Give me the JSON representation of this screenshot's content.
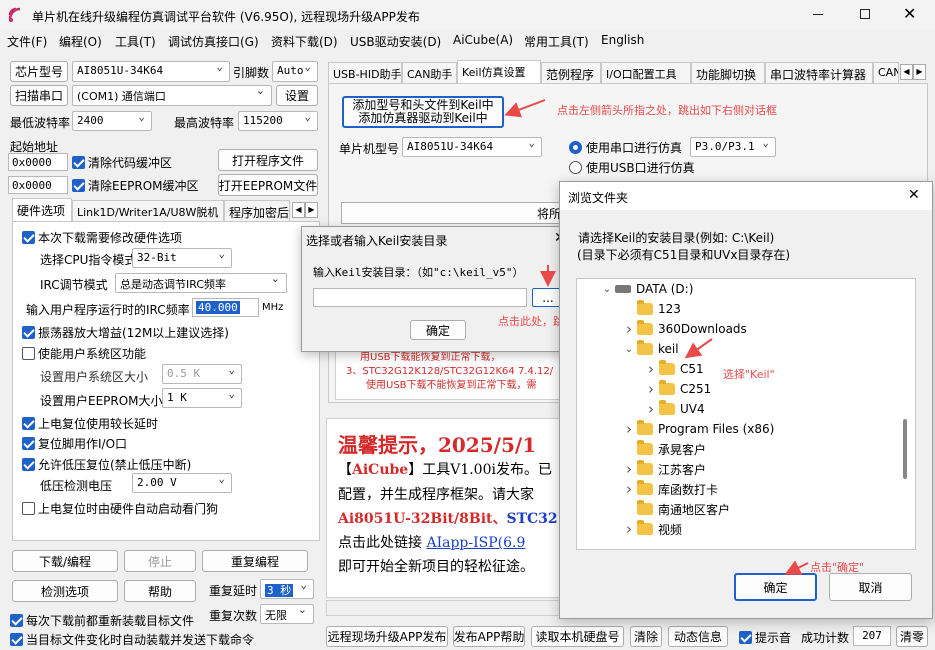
{
  "window": {
    "title": "单片机在线升级编程仿真调试平台软件 (V6.95O), 远程现场升级APP发布"
  },
  "menu": [
    "文件(F)",
    "编程(O)",
    "工具(T)",
    "调试仿真接口(G)",
    "资料下载(D)",
    "USB驱动安装(D)",
    "AiCube(A)",
    "常用工具(T)",
    "English"
  ],
  "left": {
    "chip_label": "芯片型号",
    "chip_value": "AI8051U-34K64",
    "pins_label": "引脚数",
    "pins_value": "Auto",
    "scan_button": "扫描串口",
    "port_value": "(COM1) 通信端口",
    "settings_button": "设置",
    "min_baud_label": "最低波特率",
    "min_baud_value": "2400",
    "max_baud_label": "最高波特率",
    "max_baud_value": "115200",
    "start_addr_label": "起始地址",
    "addr1": "0x0000",
    "clear_code": "清除代码缓冲区",
    "open_prog": "打开程序文件",
    "addr2": "0x0000",
    "clear_eeprom": "清除EEPROM缓冲区",
    "open_eeprom": "打开EEPROM文件",
    "tabs": [
      "硬件选项",
      "Link1D/Writer1A/U8W脱机",
      "程序加密后"
    ],
    "options": {
      "modify_hw": "本次下载需要修改硬件选项",
      "cpu_mode_label": "选择CPU指令模式",
      "cpu_mode_value": "32-Bit",
      "irc_label": "IRC调节模式",
      "irc_value": "总是动态调节IRC频率",
      "freq_label": "输入用户程序运行时的IRC频率",
      "freq_value": "40.000",
      "freq_unit": "MHz",
      "osc_gain": "振荡器放大增益(12M以上建议选择)",
      "user_sys": "使能用户系统区功能",
      "sys_size_label": "设置用户系统区大小",
      "sys_size_value": "0.5 K",
      "eeprom_size_label": "设置用户EEPROM大小",
      "eeprom_size_value": "1   K",
      "long_delay": "上电复位使用较长延时",
      "reset_io": "复位脚用作I/O口",
      "low_volt_reset": "允许低压复位(禁止低压中断)",
      "low_volt_label": "低压检测电压",
      "low_volt_value": "2.00 V",
      "watchdog": "上电复位时由硬件自动启动看门狗"
    },
    "download_button": "下载/编程",
    "stop_button": "停止",
    "reprogram_button": "重复编程",
    "detect_button": "检测选项",
    "help_button": "帮助",
    "repeat_delay_label": "重复延时",
    "repeat_delay_value": "3 秒",
    "repeat_count_label": "重复次数",
    "repeat_count_value": "无限",
    "reload_each": "每次下载前都重新装载目标文件",
    "auto_reload": "当目标文件变化时自动装载并发送下载命令"
  },
  "right": {
    "tabs": [
      "USB-HID助手",
      "CAN助手",
      "Keil仿真设置",
      "范例程序",
      "I/O口配置工具",
      "功能脚切换",
      "串口波特率计算器",
      "CAN"
    ],
    "add_btn_line1": "添加型号和头文件到Keil中",
    "add_btn_line2": "添加仿真器驱动到Keil中",
    "annot_top": "点击左侧箭头所指之处，跳出如下右侧对话框",
    "mcu_label": "单片机型号",
    "mcu_value": "AI8051U-34K64",
    "radio_serial": "使用串口进行仿真",
    "serial_port": "P3.0/P3.1",
    "radio_usb": "使用USB口进行仿真",
    "gen_btn": "将所",
    "notice_l1": "用USB下载能恢复到正常下载，",
    "notice_l2": "3、STC32G12K128/STC32G12K64  7.4.12/",
    "notice_l3": "使用USB下载不能恢复到正常下载，需",
    "tip_title": "温馨提示，2025/5/1",
    "tip_l1a": "【",
    "tip_l1b": "AiCube",
    "tip_l1c": "】工具V1.00i发布。已",
    "tip_l2": "配置，并生成程序框架。请大家",
    "tip_l3a": "Ai8051U-32Bit/8Bit、",
    "tip_l3b": "STC32",
    "tip_l4a": "点击此处链接 ",
    "tip_l4b": "AIapp-ISP(6.9",
    "tip_l5": "即可开始全新项目的轻松征途。"
  },
  "bottom": {
    "remote_btn": "远程现场升级APP发布",
    "help_app_btn": "发布APP帮助",
    "read_disk_btn": "读取本机硬盘号",
    "clear_btn": "清除",
    "dynamic_btn": "动态信息",
    "beep_label": "提示音",
    "success_label": "成功计数",
    "success_value": "207",
    "clear_count_btn": "清零"
  },
  "keil_dialog": {
    "title": "选择或者输入Keil安装目录",
    "prompt": "输入Keil安装目录：（如\"c:\\keil_v5\"）",
    "browse": "...",
    "annot": "点击此处，跳出右侧对话框",
    "ok": "确定"
  },
  "folder_dialog": {
    "title": "浏览文件夹",
    "desc1": "请选择Keil的安装目录(例如: C:\\Keil)",
    "desc2": "(目录下必须有C51目录和UVx目录存在)",
    "tree": [
      {
        "label": "DATA (D:)",
        "level": 0,
        "expanded": true,
        "drive": true
      },
      {
        "label": "123",
        "level": 1,
        "expanded": null
      },
      {
        "label": "360Downloads",
        "level": 1,
        "expanded": false
      },
      {
        "label": "keil",
        "level": 1,
        "expanded": true
      },
      {
        "label": "C51",
        "level": 2,
        "expanded": false
      },
      {
        "label": "C251",
        "level": 2,
        "expanded": false
      },
      {
        "label": "UV4",
        "level": 2,
        "expanded": false
      },
      {
        "label": "Program Files (x86)",
        "level": 1,
        "expanded": false
      },
      {
        "label": "承晃客户",
        "level": 1,
        "expanded": null
      },
      {
        "label": "江苏客户",
        "level": 1,
        "expanded": false
      },
      {
        "label": "库函数打卡",
        "level": 1,
        "expanded": false
      },
      {
        "label": "南通地区客户",
        "level": 1,
        "expanded": null
      },
      {
        "label": "视频",
        "level": 1,
        "expanded": false
      }
    ],
    "annot_keil": "选择\"Keil\"",
    "annot_ok": "点击\"确定\"",
    "ok": "确定",
    "cancel": "取消"
  },
  "colors": {
    "accent": "#1e62c9",
    "annotation": "#e84a4a",
    "tip_red": "#d42a2a",
    "link_blue": "#1a3fc4"
  }
}
